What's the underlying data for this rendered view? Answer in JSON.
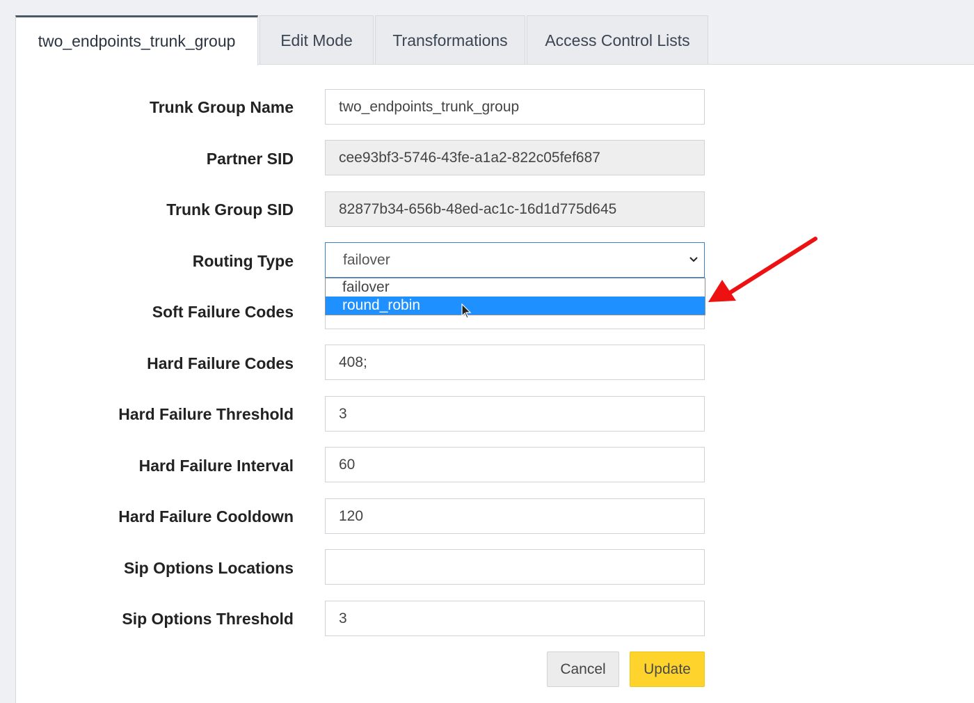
{
  "tabs": [
    {
      "label": "two_endpoints_trunk_group",
      "active": true
    },
    {
      "label": "Edit Mode"
    },
    {
      "label": "Transformations"
    },
    {
      "label": "Access Control Lists"
    }
  ],
  "form": {
    "trunk_group_name": {
      "label": "Trunk Group Name",
      "value": "two_endpoints_trunk_group"
    },
    "partner_sid": {
      "label": "Partner SID",
      "value": "cee93bf3-5746-43fe-a1a2-822c05fef687"
    },
    "trunk_group_sid": {
      "label": "Trunk Group SID",
      "value": "82877b34-656b-48ed-ac1c-16d1d775d645"
    },
    "routing_type": {
      "label": "Routing Type",
      "value": "failover",
      "options": [
        "failover",
        "round_robin"
      ],
      "highlighted": "round_robin"
    },
    "soft_failure_codes": {
      "label": "Soft Failure Codes",
      "value": ""
    },
    "hard_failure_codes": {
      "label": "Hard Failure Codes",
      "value": "408;"
    },
    "hard_failure_threshold": {
      "label": "Hard Failure Threshold",
      "value": "3"
    },
    "hard_failure_interval": {
      "label": "Hard Failure Interval",
      "value": "60"
    },
    "hard_failure_cooldown": {
      "label": "Hard Failure Cooldown",
      "value": "120"
    },
    "sip_options_locations": {
      "label": "Sip Options Locations",
      "value": ""
    },
    "sip_options_threshold": {
      "label": "Sip Options Threshold",
      "value": "3"
    }
  },
  "buttons": {
    "cancel": "Cancel",
    "update": "Update"
  },
  "colors": {
    "update_button": "#fdd32c",
    "highlight": "#1e90ff",
    "annotation_arrow": "#ee1111"
  },
  "icons": {
    "select_chevron": "chevron-down-icon",
    "cursor": "mouse-pointer-icon",
    "annotation": "red-arrow-icon"
  }
}
